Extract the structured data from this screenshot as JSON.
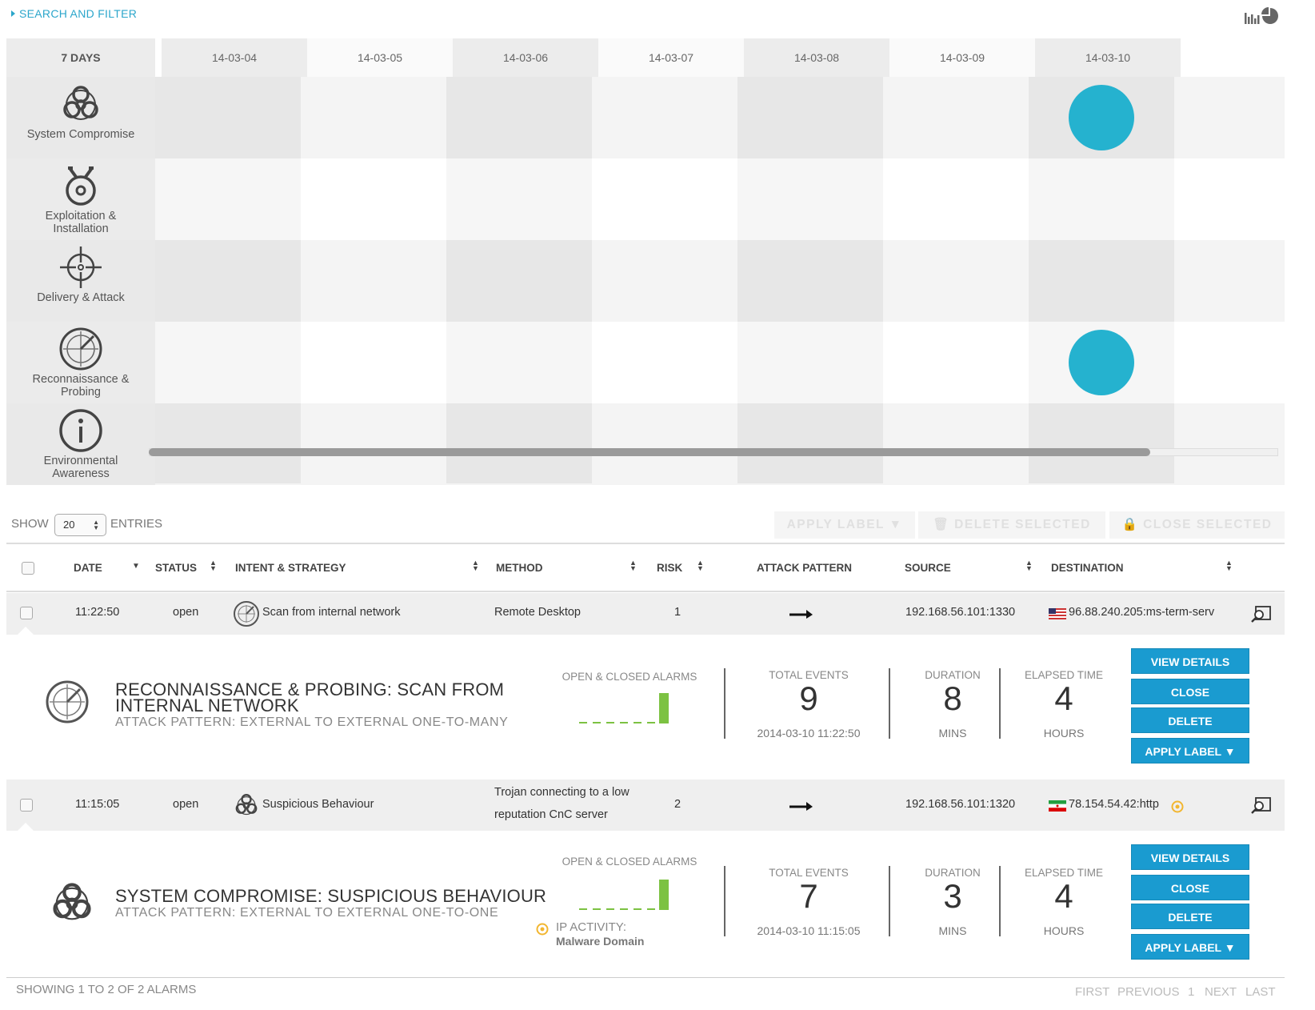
{
  "header": {
    "search_filter_label": "SEARCH AND FILTER"
  },
  "timeline": {
    "range_label": "7 DAYS",
    "days": [
      "14-03-04",
      "14-03-05",
      "14-03-06",
      "14-03-07",
      "14-03-08",
      "14-03-09",
      "14-03-10"
    ],
    "categories": [
      {
        "label_lines": [
          "System Compromise"
        ],
        "icon": "biohazard-icon"
      },
      {
        "label_lines": [
          "Exploitation &",
          "Installation"
        ],
        "icon": "bomb-icon"
      },
      {
        "label_lines": [
          "Delivery & Attack"
        ],
        "icon": "crosshair-icon"
      },
      {
        "label_lines": [
          "Reconnaissance &",
          "Probing"
        ],
        "icon": "radar-icon"
      },
      {
        "label_lines": [
          "Environmental",
          "Awareness"
        ],
        "icon": "info-icon"
      }
    ],
    "events": [
      {
        "category": "System Compromise",
        "day": "14-03-10"
      },
      {
        "category": "Reconnaissance & Probing",
        "day": "14-03-10"
      }
    ],
    "dot_color": "#25b2cf"
  },
  "controls": {
    "show_label": "SHOW",
    "entries_value": "20",
    "entries_label": "ENTRIES",
    "apply_label": "APPLY LABEL",
    "delete_selected": "DELETE SELECTED",
    "close_selected": "CLOSE SELECTED"
  },
  "table": {
    "columns": [
      "DATE",
      "STATUS",
      "INTENT & STRATEGY",
      "METHOD",
      "RISK",
      "ATTACK PATTERN",
      "SOURCE",
      "DESTINATION"
    ],
    "rows": [
      {
        "time": "11:22:50",
        "status": "open",
        "intent_icon": "radar-icon",
        "intent": "Scan from internal network",
        "method_lines": [
          "Remote Desktop"
        ],
        "risk": "1",
        "attack_pattern_icon": "right-arrow-icon",
        "source": "192.168.56.101:1330",
        "destination_flag": "us-flag-icon",
        "destination": "96.88.240.205:ms-term-serv",
        "detail": {
          "icon": "radar-icon",
          "title_prefix": "RECONNAISSANCE & PROBING:",
          "title_line1_rest": "SCAN FROM",
          "title_line2": "INTERNAL NETWORK",
          "attack_pattern": "ATTACK PATTERN: EXTERNAL TO EXTERNAL ONE-TO-MANY",
          "alarms_label": "OPEN & CLOSED ALARMS",
          "alarms_history": [
            0,
            0,
            0,
            0,
            0,
            0,
            1
          ],
          "total_events_label": "TOTAL EVENTS",
          "total_events": "9",
          "timestamp": "2014-03-10 11:22:50",
          "duration_label": "DURATION",
          "duration": "8",
          "duration_unit": "MINS",
          "elapsed_label": "ELAPSED TIME",
          "elapsed": "4",
          "elapsed_unit": "HOURS",
          "buttons": {
            "view": "VIEW DETAILS",
            "close": "CLOSE",
            "delete": "DELETE",
            "apply": "APPLY LABEL ▼"
          }
        }
      },
      {
        "time": "11:15:05",
        "status": "open",
        "intent_icon": "biohazard-icon",
        "intent": "Suspicious Behaviour",
        "method_lines": [
          "Trojan connecting to a low",
          "reputation CnC server"
        ],
        "risk": "2",
        "attack_pattern_icon": "right-arrow-icon",
        "source": "192.168.56.101:1320",
        "destination_flag": "iran-flag-icon",
        "destination": "78.154.54.42:http",
        "detail": {
          "icon": "biohazard-icon",
          "title_prefix": "SYSTEM COMPROMISE:",
          "title_line1_rest": "SUSPICIOUS BEHAVIOUR",
          "title_line2": "",
          "attack_pattern": "ATTACK PATTERN: EXTERNAL TO EXTERNAL ONE-TO-ONE",
          "alarms_label": "OPEN & CLOSED ALARMS",
          "alarms_history": [
            0,
            0,
            0,
            0,
            0,
            0,
            1
          ],
          "ip_activity_label": "IP ACTIVITY:",
          "ip_activity_value": "Malware Domain",
          "total_events_label": "TOTAL EVENTS",
          "total_events": "7",
          "timestamp": "2014-03-10 11:15:05",
          "duration_label": "DURATION",
          "duration": "3",
          "duration_unit": "MINS",
          "elapsed_label": "ELAPSED TIME",
          "elapsed": "4",
          "elapsed_unit": "HOURS",
          "buttons": {
            "view": "VIEW DETAILS",
            "close": "CLOSE",
            "delete": "DELETE",
            "apply": "APPLY LABEL ▼"
          }
        }
      }
    ]
  },
  "footer": {
    "showing": "SHOWING 1 TO 2 OF 2 ALARMS",
    "pager": {
      "first": "FIRST",
      "previous": "PREVIOUS",
      "page": "1",
      "next": "NEXT",
      "last": "LAST"
    }
  },
  "colors": {
    "accent": "#1a9bd0",
    "link": "#2ba6cb",
    "spark_bar": "#7cc242",
    "warning": "#f2b630"
  }
}
